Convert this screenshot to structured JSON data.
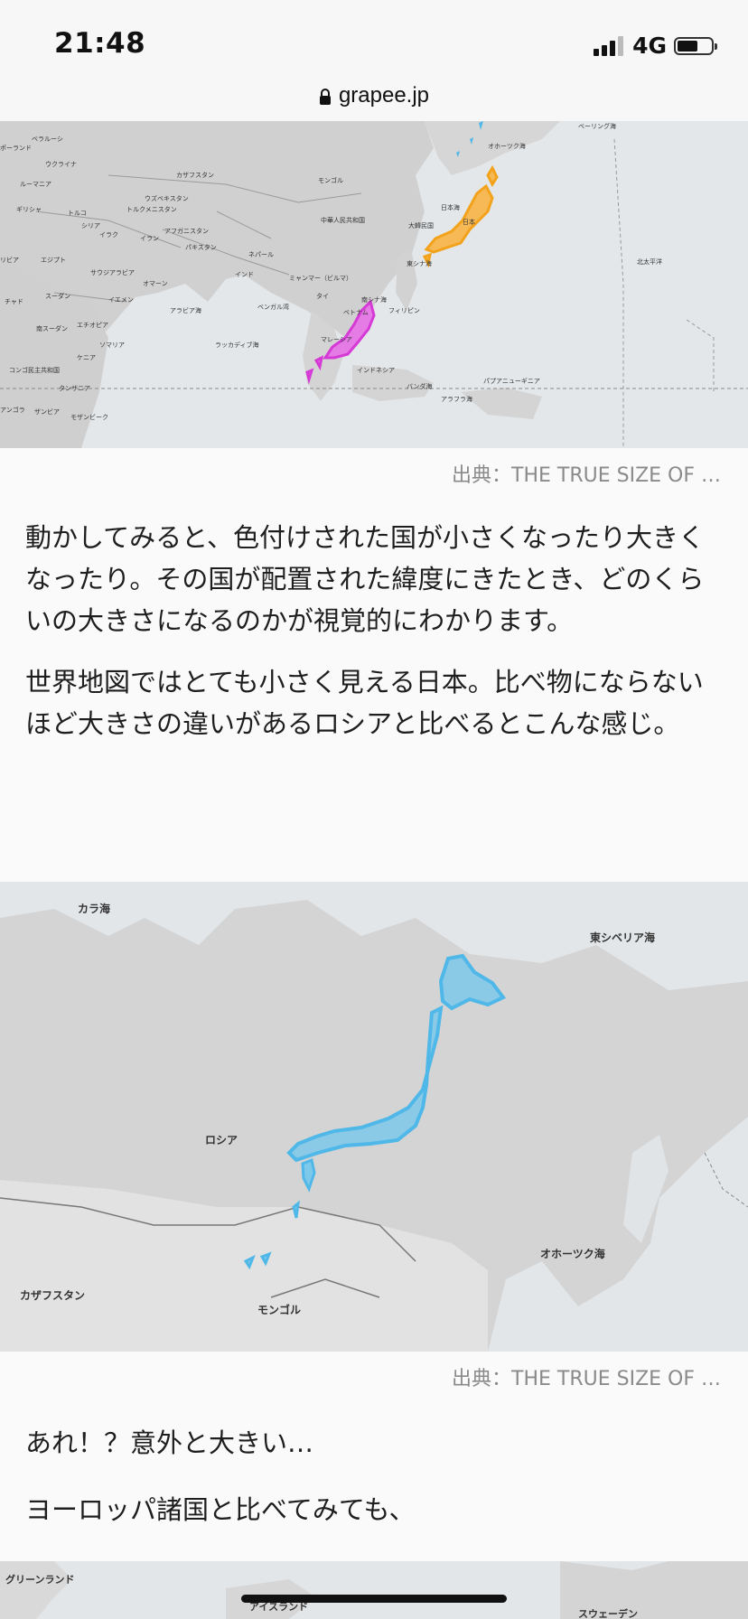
{
  "status_bar": {
    "time": "21:48",
    "network": "4G"
  },
  "browser": {
    "url": "grapee.jp"
  },
  "map1": {
    "labels": [
      "ベラルーシ",
      "ポーランド",
      "ウクライナ",
      "カザフスタン",
      "モンゴル",
      "ルーマニア",
      "ウズベキスタン",
      "トルクメニスタン",
      "ギリシャ",
      "トルコ",
      "シリア",
      "イラク",
      "イラン",
      "アフガニスタン",
      "パキスタン",
      "中華人民共和国",
      "大韓民国",
      "日本",
      "ネパール",
      "インド",
      "ミャンマー（ビルマ）",
      "サウジアラビア",
      "エジプト",
      "リビア",
      "オマーン",
      "スーダン",
      "チャド",
      "イエメン",
      "アラビア海",
      "ベンガル湾",
      "タイ",
      "ベトナム",
      "フィリピン",
      "南シナ海",
      "マレーシア",
      "インドネシア",
      "エチオピア",
      "南スーダン",
      "ソマリア",
      "ケニア",
      "ラッカディブ海",
      "コンゴ民主共和国",
      "タンザニア",
      "アンゴラ",
      "ザンビア",
      "モザンビーク",
      "バンダ海",
      "パプアニューギニア",
      "アラフラ海",
      "オホーツク海",
      "ベーリング海",
      "北太平洋",
      "東シナ海",
      "日本海"
    ]
  },
  "source1": "出典：THE TRUE SIZE OF …",
  "paragraph1": "動かしてみると、色付けされた国が小さくなったり大きくなったり。その国が配置された緯度にきたとき、どのくらいの大きさになるのかが視覚的にわかります。",
  "paragraph2": "世界地図ではとても小さく見える日本。比べ物にならないほど大きさの違いがあるロシアと比べるとこんな感じ。",
  "map2": {
    "labels": {
      "kara_sea": "カラ海",
      "east_siberian_sea": "東シベリア海",
      "russia": "ロシア",
      "okhotsk_sea": "オホーツク海",
      "kazakhstan": "カザフスタン",
      "mongolia": "モンゴル"
    }
  },
  "source2": "出典：THE TRUE SIZE OF …",
  "paragraph3": "あれ！？意外と大きい…",
  "paragraph4": "ヨーロッパ諸国と比べてみても、",
  "map3": {
    "labels": {
      "greenland": "グリーンランド",
      "iceland": "アイスランド",
      "sweden": "スウェーデン"
    }
  },
  "colors": {
    "japan_orange": "#f2a21b",
    "japan_magenta": "#d63ad6",
    "japan_blue": "#4fb8e8",
    "land": "#d2d2d2",
    "sea": "#e4e7ea"
  }
}
